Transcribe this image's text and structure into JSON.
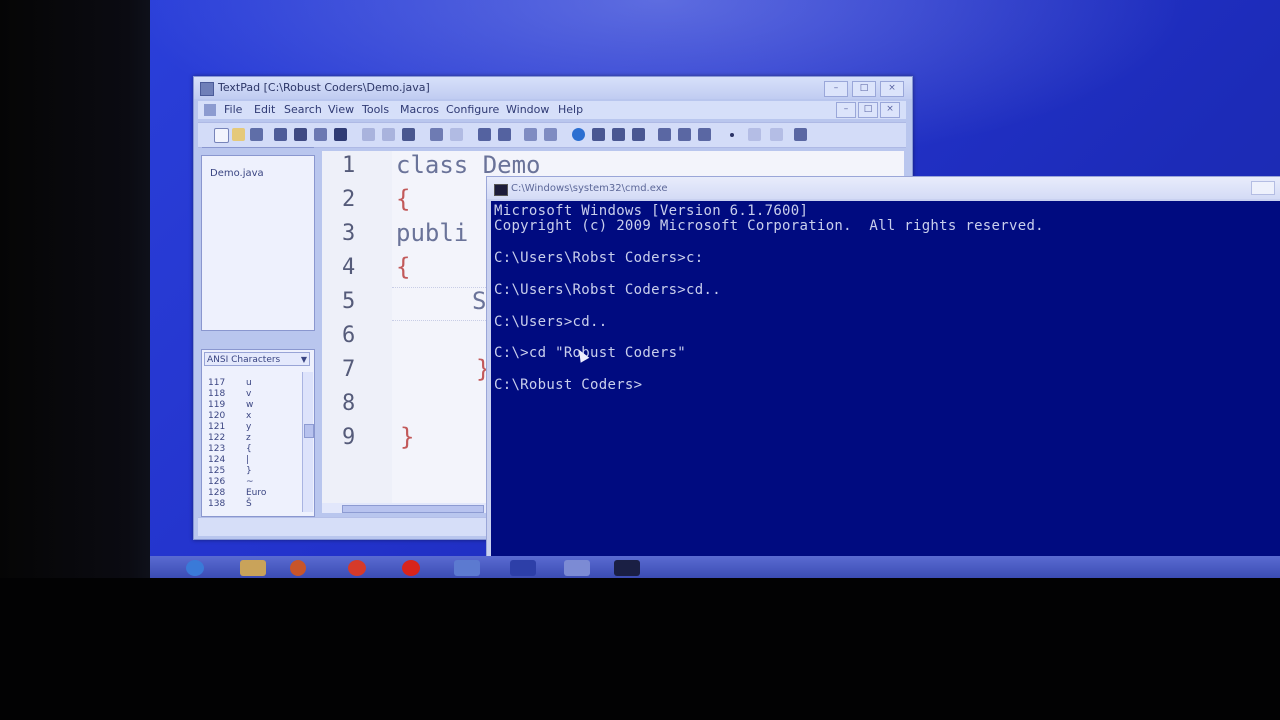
{
  "textpad": {
    "title": "TextPad   [C:\\Robust Coders\\Demo.java]",
    "menus": [
      "File",
      "Edit",
      "Search",
      "View",
      "Tools",
      "Macros",
      "Configure",
      "Window",
      "Help"
    ],
    "documents": [
      "Demo.java"
    ],
    "char_panel_title": "ANSI Characters",
    "chars": [
      {
        "code": "117",
        "char": "u"
      },
      {
        "code": "118",
        "char": "v"
      },
      {
        "code": "119",
        "char": "w"
      },
      {
        "code": "120",
        "char": "x"
      },
      {
        "code": "121",
        "char": "y"
      },
      {
        "code": "122",
        "char": "z"
      },
      {
        "code": "123",
        "char": "{"
      },
      {
        "code": "124",
        "char": "|"
      },
      {
        "code": "125",
        "char": "}"
      },
      {
        "code": "126",
        "char": "~"
      },
      {
        "code": "128",
        "char": "Euro"
      },
      {
        "code": "138",
        "char": "Š"
      }
    ],
    "line_numbers": [
      "1",
      "2",
      "3",
      "4",
      "5",
      "6",
      "7",
      "8",
      "9"
    ],
    "code_lines": [
      "class Demo",
      "{",
      "publi",
      "{",
      "S",
      "",
      "}",
      "",
      "}"
    ]
  },
  "cmd": {
    "title": "C:\\Windows\\system32\\cmd.exe",
    "lines": [
      "Microsoft Windows [Version 6.1.7600]",
      "Copyright (c) 2009 Microsoft Corporation.  All rights reserved.",
      "",
      "C:\\Users\\Robst Coders>c:",
      "",
      "C:\\Users\\Robst Coders>cd..",
      "",
      "C:\\Users>cd..",
      "",
      "C:\\>cd \"Robust Coders\"",
      "",
      "C:\\Robust Coders>"
    ]
  },
  "colors": {
    "desktop": "#2333cc",
    "console_bg": "#000b80",
    "console_text": "#c9cfec",
    "brace": "#c2595a"
  }
}
